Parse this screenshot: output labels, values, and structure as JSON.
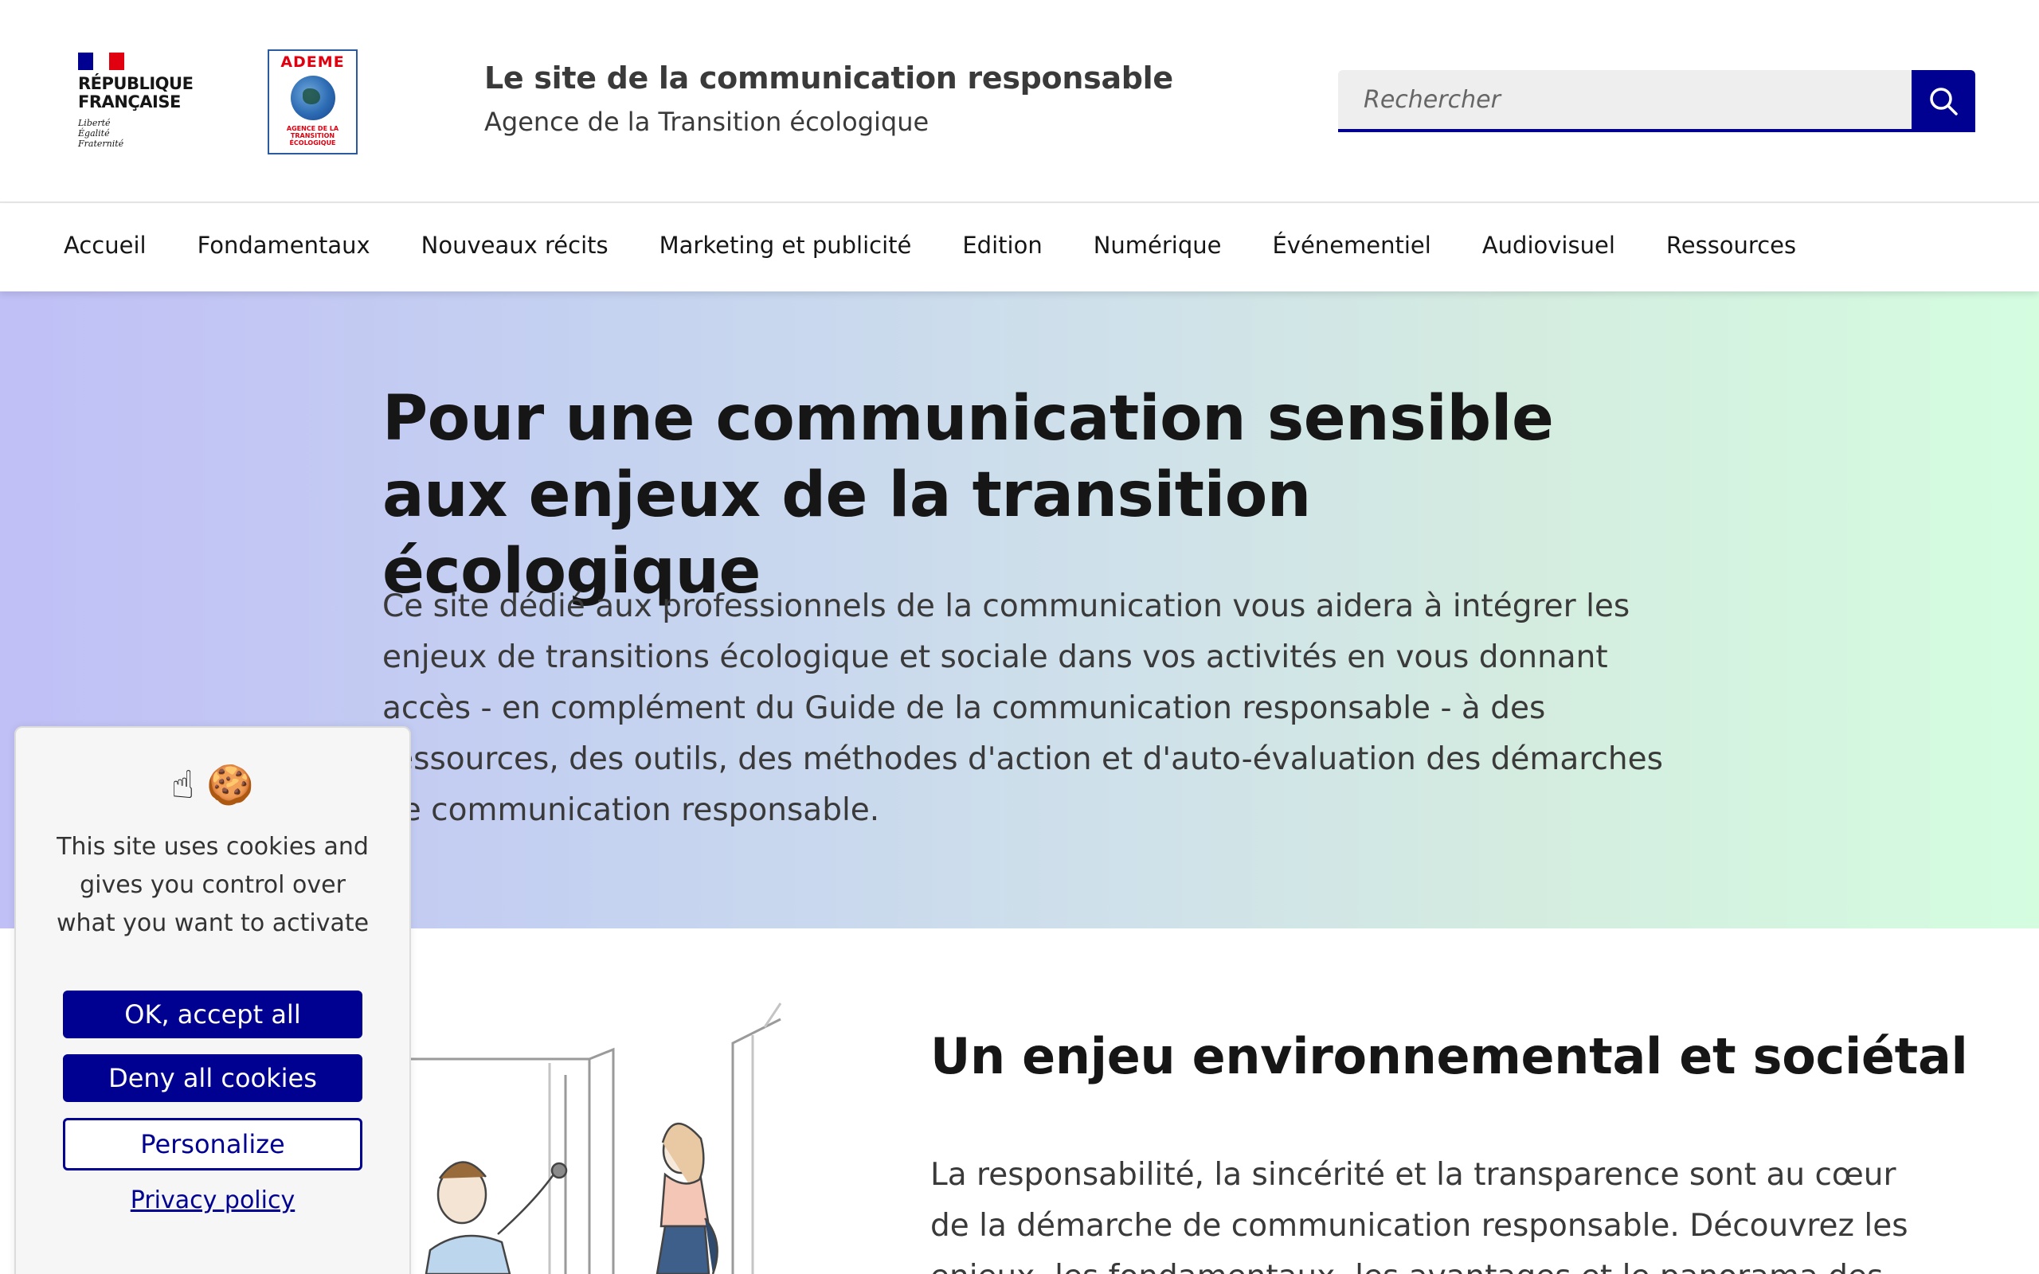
{
  "header": {
    "rf_logo": {
      "line1": "RÉPUBLIQUE",
      "line2": "FRANÇAISE",
      "motto": [
        "Liberté",
        "Égalité",
        "Fraternité"
      ]
    },
    "ademe_logo": {
      "name": "ADEME",
      "sub": [
        "AGENCE DE LA",
        "TRANSITION",
        "ÉCOLOGIQUE"
      ]
    },
    "site_title": "Le site de la communication responsable",
    "site_tagline": "Agence de la Transition écologique",
    "search": {
      "placeholder": "Rechercher",
      "icon": "search-icon"
    }
  },
  "nav": {
    "items": [
      "Accueil",
      "Fondamentaux",
      "Nouveaux récits",
      "Marketing et publicité",
      "Edition",
      "Numérique",
      "Événementiel",
      "Audiovisuel",
      "Ressources"
    ]
  },
  "hero": {
    "title": "Pour une communication sensible aux enjeux de la transition écologique",
    "text": "Ce site dédié aux professionnels de la communication vous aidera à intégrer les enjeux de transitions écologique et sociale dans vos activités en vous donnant accès - en complément du Guide de la communication responsable - à des ressources, des outils, des méthodes d'action et d'auto-évaluation des démarches de communication responsable."
  },
  "section": {
    "title": "Un enjeu environnemental et sociétal",
    "text": "La responsabilité, la sincérité et la transparence sont au cœur de la démarche de communication responsable. Découvrez les enjeux, les fondamentaux, les avantages et le panorama des"
  },
  "cookie_banner": {
    "icons": "☝ 🍪",
    "message": "This site uses cookies and gives you control over what you want to activate",
    "accept_label": "OK, accept all",
    "deny_label": "Deny all cookies",
    "personalize_label": "Personalize",
    "privacy_label": "Privacy policy"
  },
  "colors": {
    "primary_blue": "#000091",
    "marianne_red": "#e1000f",
    "hero_gradient_start": "#c0bff6",
    "hero_gradient_end": "#d4fde0",
    "search_bg": "#eeeeee"
  }
}
